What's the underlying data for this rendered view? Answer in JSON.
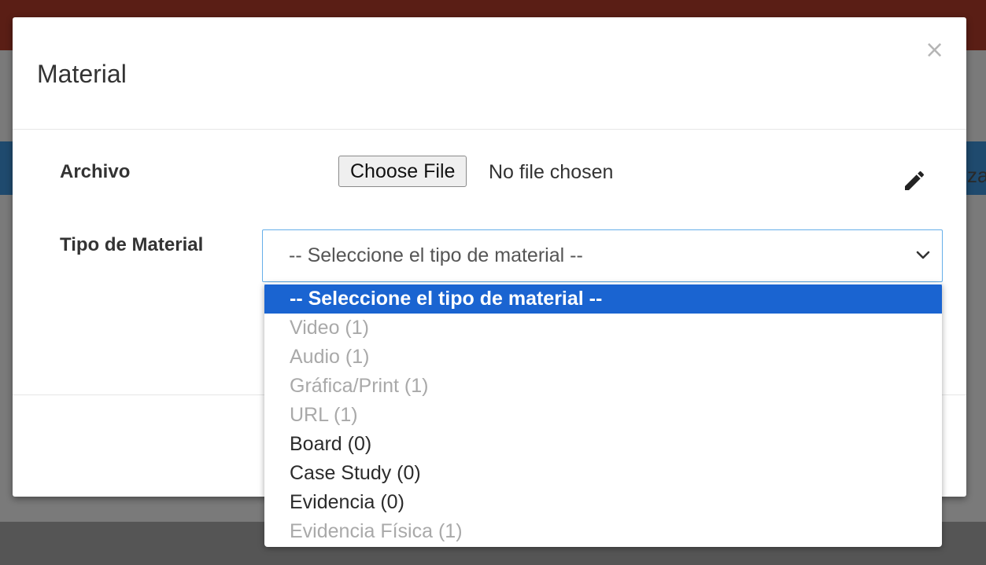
{
  "modal": {
    "title": "Material",
    "close_symbol": "×",
    "close_icon": "close-icon"
  },
  "form": {
    "archivo_label": "Archivo",
    "file_button": "Choose File",
    "file_status": "No file chosen",
    "edit_icon": "pencil-icon",
    "tipo_label": "Tipo de Material",
    "select_value": "-- Seleccione el tipo de material --",
    "select_icon": "chevron-down-icon"
  },
  "dropdown": {
    "options": [
      {
        "label": "-- Seleccione el tipo de material --",
        "state": "selected"
      },
      {
        "label": "Video (1)",
        "state": "disabled"
      },
      {
        "label": "Audio (1)",
        "state": "disabled"
      },
      {
        "label": "Gráfica/Print (1)",
        "state": "disabled"
      },
      {
        "label": "URL (1)",
        "state": "disabled"
      },
      {
        "label": "Board (0)",
        "state": "enabled"
      },
      {
        "label": "Case Study (0)",
        "state": "enabled"
      },
      {
        "label": "Evidencia (0)",
        "state": "enabled"
      },
      {
        "label": "Evidencia Física (1)",
        "state": "disabled"
      }
    ]
  },
  "background": {
    "peek_text": "za"
  },
  "colors": {
    "highlight": "#1a64d1",
    "focus_border": "#66afe9",
    "header_bar": "#5a1e15",
    "disabled_text": "#a9a9a9"
  }
}
